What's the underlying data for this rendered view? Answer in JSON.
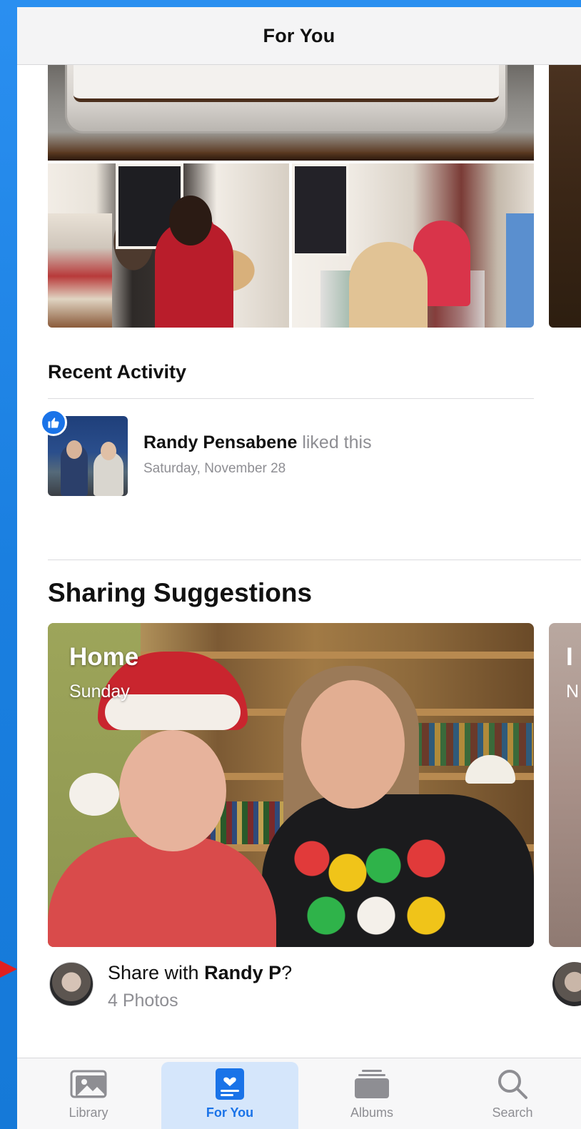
{
  "navbar": {
    "title": "For You"
  },
  "recent_activity": {
    "title": "Recent Activity",
    "item": {
      "name": "Randy Pensabene",
      "action": "liked this",
      "date": "Saturday, November 28"
    }
  },
  "sharing_suggestions": {
    "title": "Sharing Suggestions",
    "card": {
      "title": "Home",
      "subtitle": "Sunday"
    },
    "peek_card": {
      "title": "I",
      "subtitle": "N"
    },
    "prompt_prefix": "Share with ",
    "prompt_name": "Randy P",
    "prompt_suffix": "?",
    "count": "4 Photos"
  },
  "tabbar": {
    "library": "Library",
    "for_you": "For You",
    "albums": "Albums",
    "search": "Search"
  },
  "colors": {
    "accent": "#1a73e8",
    "tab_selected_bg": "#d5e6fb",
    "secondary_text": "#8e8e93"
  }
}
